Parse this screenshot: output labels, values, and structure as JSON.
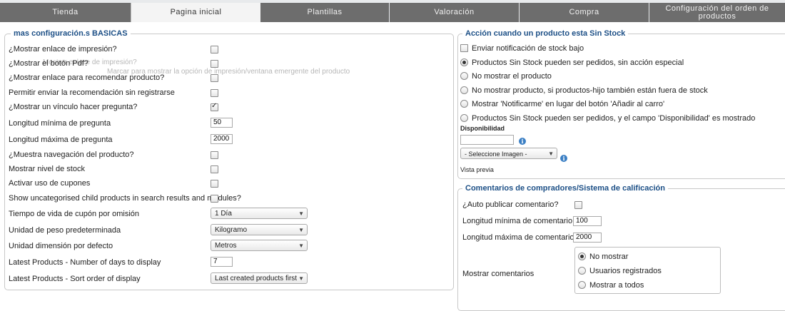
{
  "tabs": [
    {
      "label": "Tienda",
      "active": false
    },
    {
      "label": "Pagina inicial",
      "active": true
    },
    {
      "label": "Plantillas",
      "active": false
    },
    {
      "label": "Valoración",
      "active": false
    },
    {
      "label": "Compra",
      "active": false
    },
    {
      "label": "Configuración del orden de productos",
      "active": false
    }
  ],
  "left": {
    "legend": "mas configuración.s BASICAS",
    "ghost1": "Mostrar enlace de impresión?",
    "ghost2": "Marcar para mostrar la opción de impresión/ventana emergente del producto",
    "rows": [
      {
        "label": "¿Mostrar enlace de impresión?",
        "type": "checkbox",
        "checked": false
      },
      {
        "label": "¿Mostrar el botón Pdf?",
        "type": "checkbox",
        "checked": false
      },
      {
        "label": "¿Mostrar enlace para recomendar producto?",
        "type": "checkbox",
        "checked": false
      },
      {
        "label": "Permitir enviar la recomendación sin registrarse",
        "type": "checkbox",
        "checked": false
      },
      {
        "label": "¿Mostrar un vínculo hacer pregunta?",
        "type": "checkbox",
        "checked": true
      },
      {
        "label": "Longitud mínima de pregunta",
        "type": "text",
        "value": "50"
      },
      {
        "label": "Longitud máxima de pregunta",
        "type": "text",
        "value": "2000"
      },
      {
        "label": "¿Muestra navegación del producto?",
        "type": "checkbox",
        "checked": false
      },
      {
        "label": "Mostrar nivel de stock",
        "type": "checkbox",
        "checked": false
      },
      {
        "label": "Activar uso de cupones",
        "type": "checkbox",
        "checked": false
      },
      {
        "label": "Show uncategorised child products in search results and modules?",
        "type": "checkbox",
        "checked": false
      },
      {
        "label": "Tiempo de vida de cupón por omisión",
        "type": "select",
        "value": "1 Día"
      },
      {
        "label": "Unidad de peso predeterminada",
        "type": "select",
        "value": "Kilogramo"
      },
      {
        "label": "Unidad dimensión por defecto",
        "type": "select",
        "value": "Metros"
      },
      {
        "label": "Latest Products - Number of days to display",
        "type": "text",
        "value": "7"
      },
      {
        "label": "Latest Products - Sort order of display",
        "type": "select",
        "value": "Last created products first"
      }
    ]
  },
  "stock": {
    "legend": "Acción cuando un producto esta Sin Stock",
    "notify_label": "Enviar notificación de stock bajo",
    "options": [
      {
        "label": "Productos Sin Stock pueden ser pedidos, sin acción especial",
        "selected": true
      },
      {
        "label": "No mostrar el producto",
        "selected": false
      },
      {
        "label": "No mostrar producto, si productos-hijo también están fuera de stock",
        "selected": false
      },
      {
        "label": "Mostrar 'Notificarme' en lugar del botón 'Añadir al carro'",
        "selected": false
      },
      {
        "label": "Productos Sin Stock pueden ser pedidos, y el campo 'Disponibilidad' es mostrado",
        "selected": false
      }
    ],
    "disponibilidad_label": "Disponibilidad",
    "disponibilidad_value": "",
    "image_select": "- Seleccione Imagen -",
    "preview_label": "Vista previa"
  },
  "reviews": {
    "legend": "Comentarios de compradores/Sistema de calificación",
    "auto_publish_label": "¿Auto publicar comentario?",
    "min_label": "Longitud mínima de comentario",
    "min_value": "100",
    "max_label": "Longitud máxima de comentario",
    "max_value": "2000",
    "show_label": "Mostrar comentarios",
    "show_options": [
      {
        "label": "No mostrar",
        "selected": true
      },
      {
        "label": "Usuarios registrados",
        "selected": false
      },
      {
        "label": "Mostrar a todos",
        "selected": false
      }
    ]
  },
  "icons": {
    "info": "i",
    "dropdown": "▼",
    "check": "✓"
  },
  "colors": {
    "tab_bg": "#6d6d6d",
    "legend": "#1c4f86",
    "info": "#3b7fc4"
  }
}
